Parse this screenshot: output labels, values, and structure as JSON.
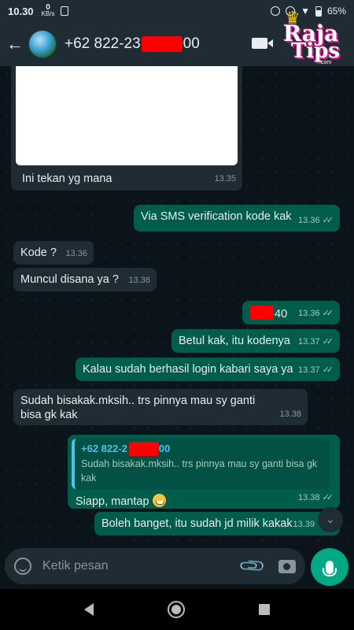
{
  "status_bar": {
    "time": "10.30",
    "net_speed_value": "0",
    "net_speed_unit": "KB/s",
    "battery": "65%"
  },
  "header": {
    "contact_prefix": "+62 822-23",
    "contact_suffix": "00"
  },
  "logo": {
    "line1": "Raja",
    "line2": "Tips",
    "domain": ".com"
  },
  "messages": [
    {
      "id": "m1",
      "direction": "in",
      "text": "Ini tekan yg mana",
      "time": "13.35",
      "has_image": true
    },
    {
      "id": "m2",
      "direction": "out",
      "text": "Via SMS verification kode kak",
      "time": "13.36",
      "status": "read"
    },
    {
      "id": "m3",
      "direction": "in",
      "text": "Kode ?",
      "time": "13.36"
    },
    {
      "id": "m4",
      "direction": "in",
      "text": "Muncul disana ya ?",
      "time": "13.36"
    },
    {
      "id": "m5",
      "direction": "out",
      "text": "40",
      "time": "13.36",
      "status": "read",
      "redacted_prefix": true
    },
    {
      "id": "m6",
      "direction": "out",
      "text": "Betul kak, itu kodenya",
      "time": "13.37",
      "status": "read"
    },
    {
      "id": "m7",
      "direction": "out",
      "text": "Kalau sudah berhasil login kabari saya ya",
      "time": "13.37",
      "status": "read"
    },
    {
      "id": "m8",
      "direction": "in",
      "text": "Sudah bisakak.mksih.. trs pinnya mau sy ganti bisa gk kak",
      "time": "13.38"
    },
    {
      "id": "m9",
      "direction": "out",
      "text": "Siapp, mantap",
      "time": "13.38",
      "status": "read",
      "quote": {
        "name_prefix": "+62 822-2",
        "name_suffix": "00",
        "text": "Sudah bisakak.mksih.. trs pinnya mau sy ganti bisa gk kak"
      }
    },
    {
      "id": "m10",
      "direction": "out",
      "text": "Boleh banget, itu sudah jd milik kakak",
      "time": "13.39",
      "status": "read"
    }
  ],
  "input": {
    "placeholder": "Ketik pesan"
  },
  "colors": {
    "background": "#0b141a",
    "incoming_bubble": "#1f2c34",
    "outgoing_bubble": "#005c4b",
    "accent": "#00a884",
    "quote_name": "#53bdeb",
    "redaction": "#ff0000"
  },
  "icons": {
    "back": "arrow-left",
    "video": "video-camera",
    "emoji": "smiley",
    "attach": "paperclip",
    "camera": "camera",
    "mic": "microphone",
    "scroll": "double-chevron-down"
  }
}
